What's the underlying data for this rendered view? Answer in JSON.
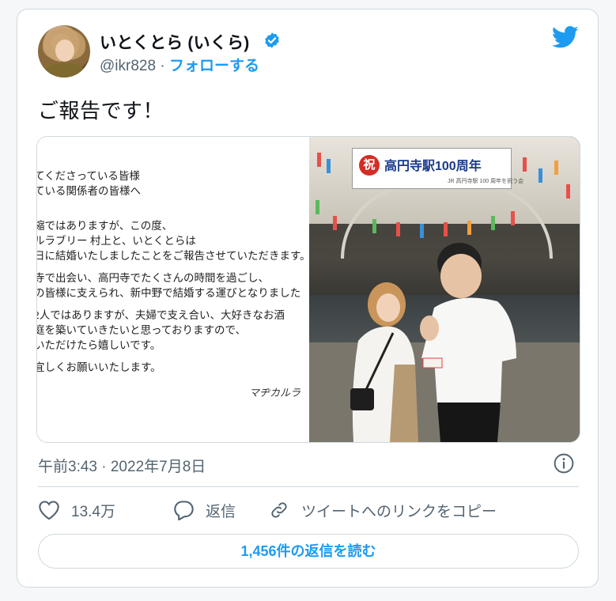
{
  "tweet": {
    "author_name": "いとくとら (いくら)",
    "handle": "@ikr828",
    "separator": "·",
    "follow_label": "フォローする",
    "text": "ご報告です！",
    "timestamp": "午前3:43 · 2022年7月8日"
  },
  "media": {
    "letter_lines": [
      "てくださっている皆様",
      "ている関係者の皆様へ",
      "縮ではありますが、この度、",
      "ルラブリー 村上と、いとくとらは",
      "日に結婚いたしましたことをご報告させていただきます。",
      "寺で出会い、高円寺でたくさんの時間を過ごし、",
      "の皆様に支えられ、新中野で結婚する運びとなりました",
      "2人ではありますが、夫婦で支え合い、大好きなお酒",
      "庭を築いていきたいと思っておりますので、",
      "いただけたら嬉しいです。",
      "宜しくお願いいたします。"
    ],
    "signature": "マヂカルラ",
    "banner_mark": "祝",
    "banner_text": "高円寺駅100周年",
    "banner_small": "JR 高円寺駅 100 周年を祝う会"
  },
  "actions": {
    "likes": "13.4万",
    "reply": "返信",
    "copy_link": "ツイートへのリンクをコピー"
  },
  "read_replies": "1,456件の返信を読む",
  "colors": {
    "accent": "#1d9bf0",
    "text": "#0f1419",
    "secondary": "#536471",
    "border": "#cfd9de"
  },
  "icons": [
    "verified-badge-icon",
    "twitter-bird-icon",
    "info-icon",
    "heart-icon",
    "reply-bubble-icon",
    "link-icon"
  ]
}
